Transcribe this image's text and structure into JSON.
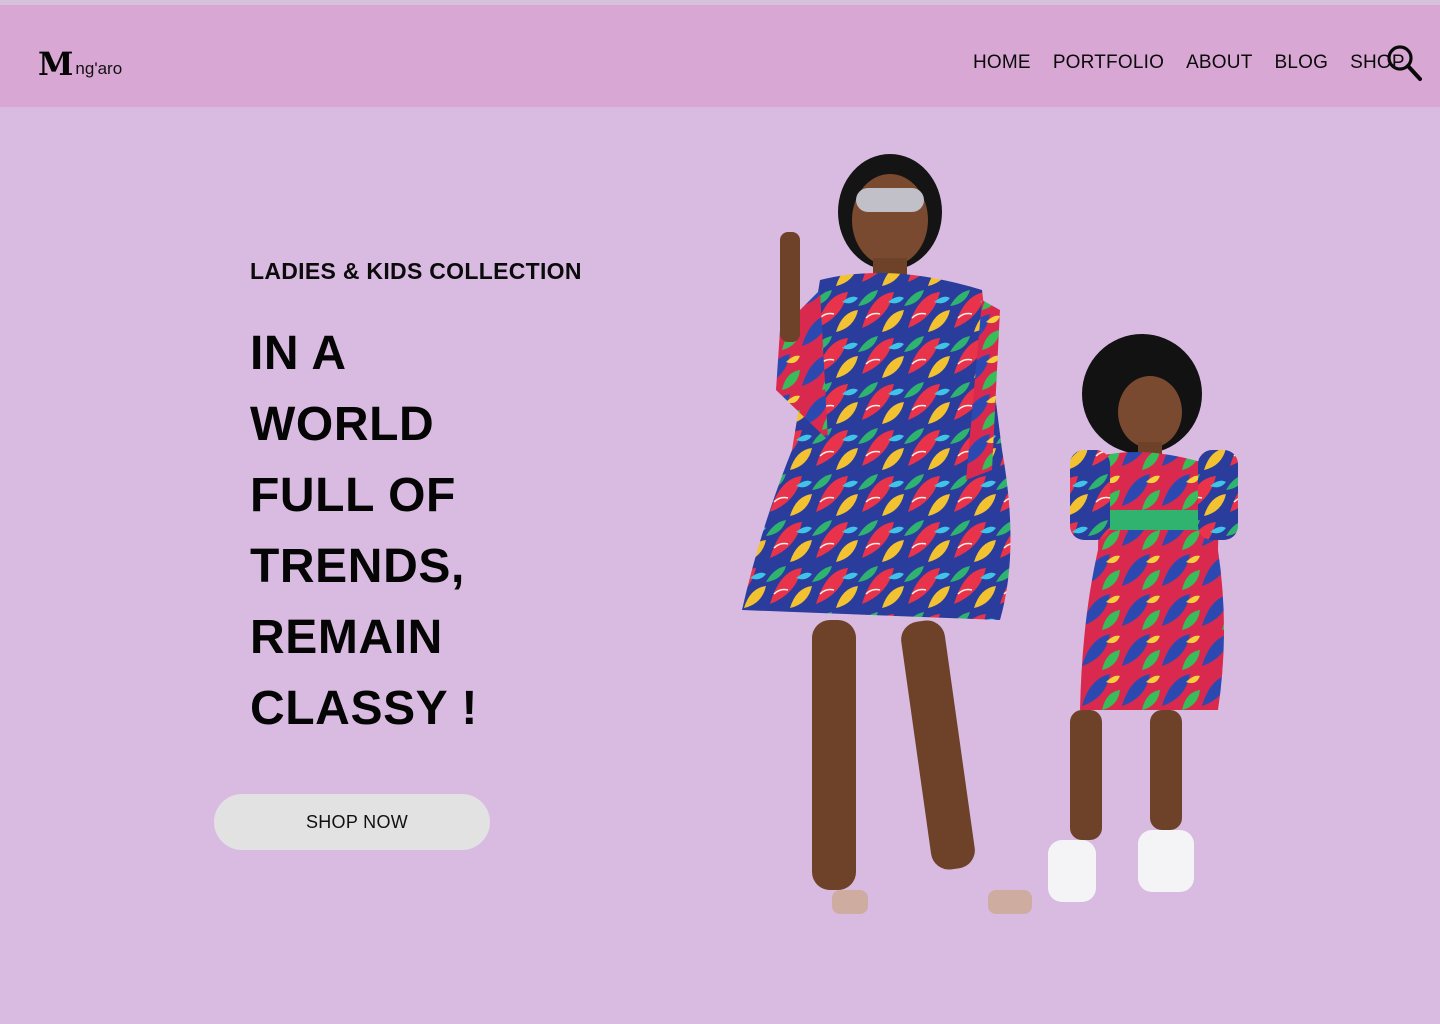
{
  "brand": {
    "mark": "M",
    "word": "ng'aro"
  },
  "nav": {
    "items": [
      {
        "label": "HOME"
      },
      {
        "label": "PORTFOLIO"
      },
      {
        "label": "ABOUT"
      },
      {
        "label": "BLOG"
      },
      {
        "label": "SHOP"
      }
    ],
    "search_icon": "search-icon"
  },
  "hero": {
    "subtitle": "LADIES & KIDS COLLECTION",
    "headline_lines": [
      "IN A",
      "WORLD",
      "FULL OF",
      "TRENDS,",
      "REMAIN",
      "CLASSY !"
    ],
    "cta_label": "SHOP NOW",
    "image": "woman-and-girl-in-matching-print-dresses"
  },
  "colors": {
    "page_bg": "#d9bbe2",
    "header_bg": "#d8a7d4",
    "button_bg": "#e2e2e2",
    "text": "#050505"
  }
}
